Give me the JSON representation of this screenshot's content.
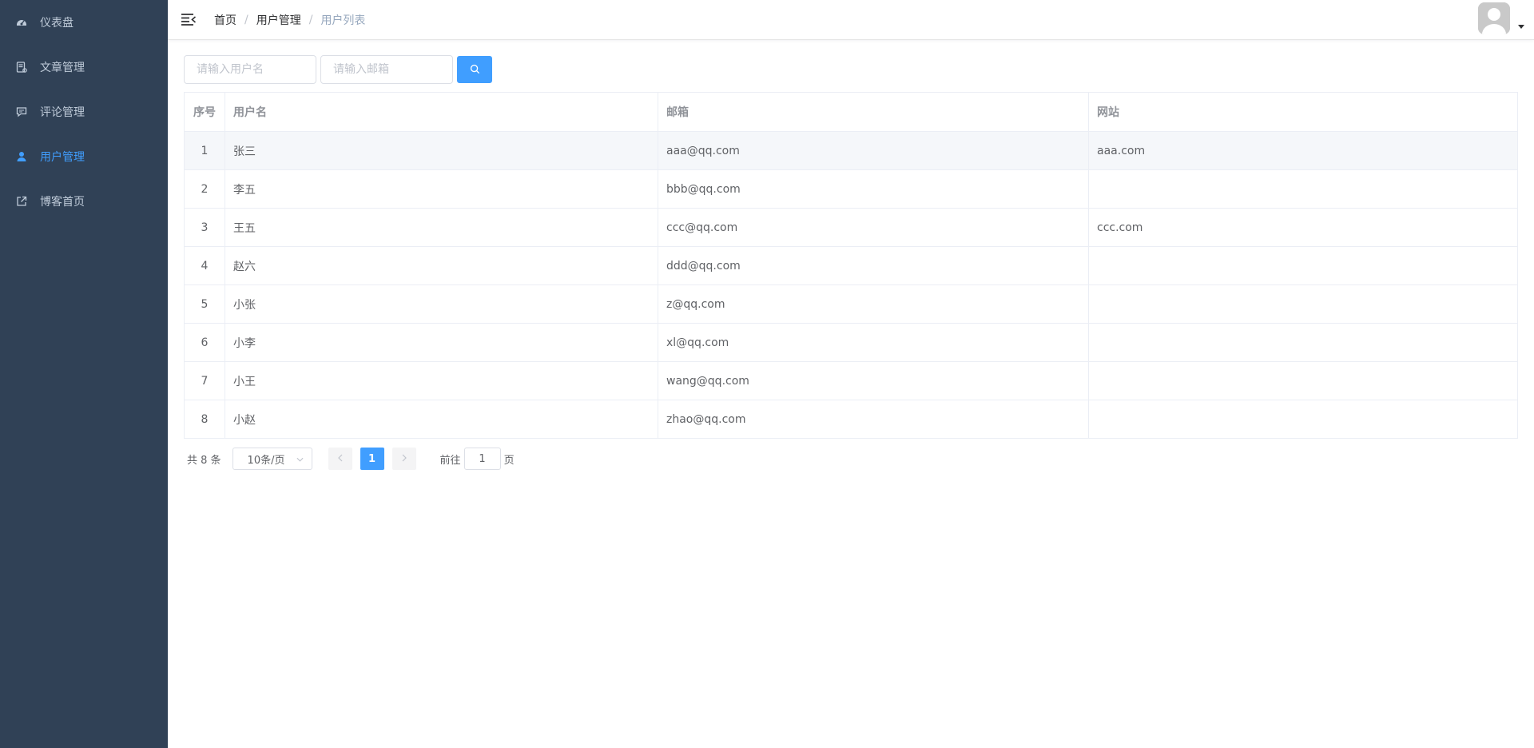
{
  "sidebar": {
    "items": [
      {
        "label": "仪表盘",
        "icon": "dashboard-icon",
        "active": false
      },
      {
        "label": "文章管理",
        "icon": "article-icon",
        "active": false
      },
      {
        "label": "评论管理",
        "icon": "comment-icon",
        "active": false
      },
      {
        "label": "用户管理",
        "icon": "user-icon",
        "active": true
      },
      {
        "label": "博客首页",
        "icon": "external-link-icon",
        "active": false
      }
    ]
  },
  "header": {
    "breadcrumb": [
      "首页",
      "用户管理",
      "用户列表"
    ],
    "breadcrumb_separator": "/"
  },
  "filter": {
    "username_placeholder": "请输入用户名",
    "email_placeholder": "请输入邮箱"
  },
  "table": {
    "columns": [
      "序号",
      "用户名",
      "邮箱",
      "网站"
    ],
    "rows": [
      {
        "index": "1",
        "username": "张三",
        "email": "aaa@qq.com",
        "website": "aaa.com"
      },
      {
        "index": "2",
        "username": "李五",
        "email": "bbb@qq.com",
        "website": ""
      },
      {
        "index": "3",
        "username": "王五",
        "email": "ccc@qq.com",
        "website": "ccc.com"
      },
      {
        "index": "4",
        "username": "赵六",
        "email": "ddd@qq.com",
        "website": ""
      },
      {
        "index": "5",
        "username": "小张",
        "email": "z@qq.com",
        "website": ""
      },
      {
        "index": "6",
        "username": "小李",
        "email": "xl@qq.com",
        "website": ""
      },
      {
        "index": "7",
        "username": "小王",
        "email": "wang@qq.com",
        "website": ""
      },
      {
        "index": "8",
        "username": "小赵",
        "email": "zhao@qq.com",
        "website": ""
      }
    ]
  },
  "pagination": {
    "total_text": "共 8 条",
    "page_size": "10条/页",
    "current_page": "1",
    "goto_prefix": "前往",
    "goto_value": "1",
    "goto_suffix": "页"
  },
  "colors": {
    "sidebar_bg": "#304156",
    "sidebar_text": "#bfcbd9",
    "accent": "#409eff"
  }
}
